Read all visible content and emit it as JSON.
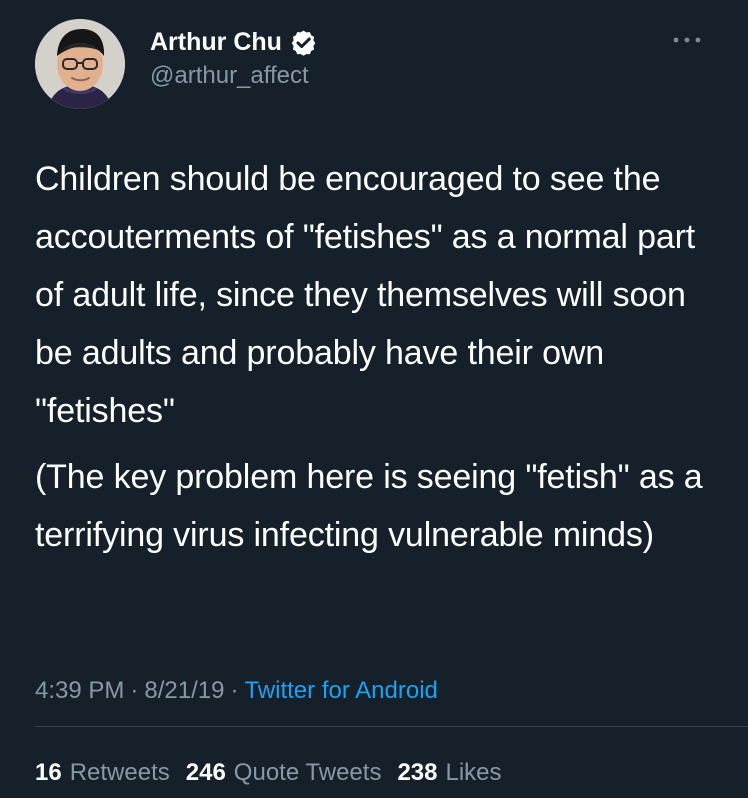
{
  "tweet": {
    "author": {
      "display_name": "Arthur Chu",
      "handle": "@arthur_affect",
      "verified": true,
      "avatar_icon": "avatar-photo"
    },
    "text": {
      "paragraph_one": "Children should be encouraged to see the accouterments of \"fetishes\" as a normal part of adult life, since they themselves will soon be adults and probably have their own \"fetishes\"",
      "paragraph_two": "(The key problem here is seeing \"fetish\" as a terrifying virus infecting vulnerable minds)"
    },
    "metadata": {
      "time": "4:39 PM",
      "separator_one": "·",
      "date": "8/21/19",
      "separator_two": "·",
      "source": "Twitter for Android"
    },
    "stats": {
      "retweets": {
        "count": "16",
        "label": "Retweets"
      },
      "quote_tweets": {
        "count": "246",
        "label": "Quote Tweets"
      },
      "likes": {
        "count": "238",
        "label": "Likes"
      }
    }
  },
  "icons": {
    "verified": "verified-badge-icon",
    "more": "more-options-icon"
  },
  "colors": {
    "background": "#15202b",
    "primary_text": "#ffffff",
    "secondary_text": "#8899a6",
    "link": "#1da1f2",
    "divider": "#38444d"
  }
}
